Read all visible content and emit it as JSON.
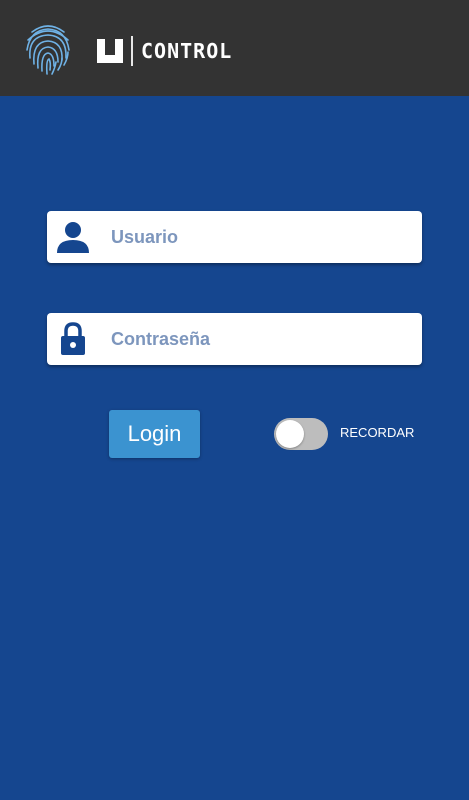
{
  "header": {
    "brand_text": "CONTROL",
    "logo_icon": "fingerprint-icon",
    "background": "#333333"
  },
  "login_form": {
    "username": {
      "placeholder": "Usuario",
      "value": "",
      "icon": "user-icon"
    },
    "password": {
      "placeholder": "Contraseña",
      "value": "",
      "icon": "lock-icon"
    },
    "login_label": "Login",
    "remember": {
      "label": "RECORDAR",
      "checked": false
    }
  },
  "colors": {
    "background": "#15468f",
    "button": "#3b93d0",
    "icon": "#15468f",
    "toggle_off": "#bdbdbd"
  }
}
